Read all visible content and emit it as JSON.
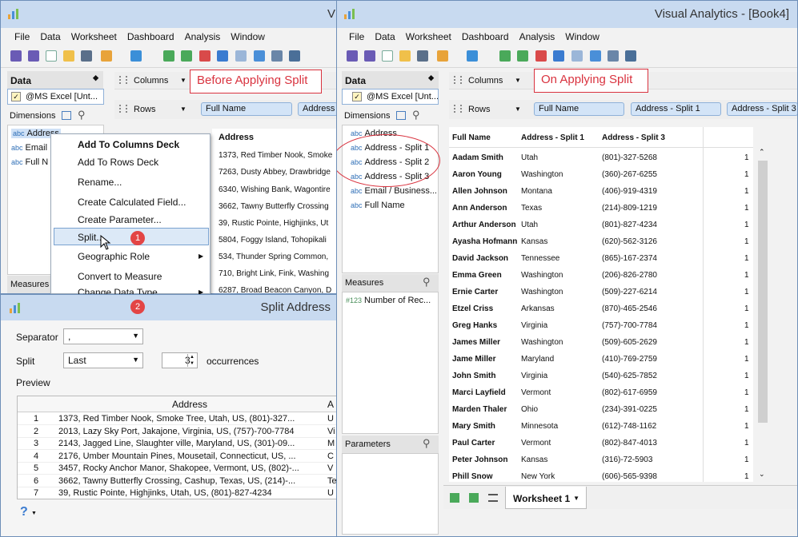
{
  "left_window": {
    "title": "V",
    "menu": [
      "File",
      "Data",
      "Worksheet",
      "Dashboard",
      "Analysis",
      "Window"
    ],
    "data_header": "Data",
    "datasource": "@MS Excel [Unt...",
    "dimensions_label": "Dimensions",
    "measures_label": "Measures",
    "dimension_fields": [
      "Address",
      "Email",
      "Full N"
    ],
    "columns_label": "Columns",
    "rows_label": "Rows",
    "rows_pills": [
      "Full Name",
      "Address"
    ],
    "table_header": "Address",
    "table_rows": [
      "1373, Red Timber Nook, Smoke",
      "7263, Dusty Abbey, Drawbridge",
      "6340, Wishing Bank, Wagontire",
      "3662, Tawny Butterfly Crossing",
      "39, Rustic Pointe, Highjinks, Ut",
      "5804, Foggy Island, Tohopikali",
      "534, Thunder Spring Common,",
      "710, Bright Link, Fink, Washing",
      "6287, Broad Beacon Canyon, D"
    ]
  },
  "callout_before": "Before Applying Split",
  "context_menu": {
    "items": [
      "Add To Columns Deck",
      "Add To Rows Deck",
      "Rename...",
      "Create Calculated Field...",
      "Create Parameter...",
      "Split...",
      "Geographic Role",
      "Convert to Measure",
      "Change Data Type"
    ],
    "badge": "1"
  },
  "split_dialog": {
    "title": "Split Address",
    "badge": "2",
    "separator_label": "Separator",
    "separator_value": ",",
    "split_label": "Split",
    "split_value": "Last",
    "occurrences_value": "3",
    "occurrences_label": "occurrences",
    "preview_label": "Preview",
    "preview_header": "Address",
    "preview_header_2": "A",
    "preview_rows": [
      {
        "n": "1",
        "addr": "1373, Red Timber Nook, Smoke Tree, Utah, US, (801)-327...",
        "c": "U"
      },
      {
        "n": "2",
        "addr": "2013, Lazy Sky Port, Jakajone, Virginia, US, (757)-700-7784",
        "c": "Vi"
      },
      {
        "n": "3",
        "addr": "2143, Jagged Line, Slaughter ville, Maryland, US, (301)-09...",
        "c": "M"
      },
      {
        "n": "4",
        "addr": "2176, Umber Mountain Pines, Mousetail, Connecticut, US, ...",
        "c": "C"
      },
      {
        "n": "5",
        "addr": "3457, Rocky Anchor Manor, Shakopee, Vermont, US, (802)-...",
        "c": "V"
      },
      {
        "n": "6",
        "addr": "3662, Tawny Butterfly Crossing, Cashup, Texas, US, (214)-...",
        "c": "Te"
      },
      {
        "n": "7",
        "addr": "39, Rustic Pointe, Highjinks, Utah, US, (801)-827-4234",
        "c": "U"
      }
    ],
    "help": "?"
  },
  "right_window": {
    "title": "Visual Analytics - [Book4]",
    "menu": [
      "File",
      "Data",
      "Worksheet",
      "Dashboard",
      "Analysis",
      "Window"
    ],
    "data_header": "Data",
    "datasource": "@MS Excel [Unt...",
    "dimensions_label": "Dimensions",
    "dimension_fields": [
      "Address",
      "Address - Split 1",
      "Address - Split 2",
      "Address - Split 3",
      "Email / Business...",
      "Full Name"
    ],
    "measures_label": "Measures",
    "measure_fields": [
      "Number of Rec..."
    ],
    "parameters_label": "Parameters",
    "columns_label": "Columns",
    "rows_label": "Rows",
    "rows_pills": [
      "Full Name",
      "Address - Split 1",
      "Address - Split 3"
    ],
    "headers": [
      "Full Name",
      "Address - Split 1",
      "Address - Split 3"
    ],
    "rows": [
      {
        "name": "Aadam Smith",
        "state": "Utah",
        "phone": "(801)-327-5268",
        "v": "1"
      },
      {
        "name": "Aaron Young",
        "state": "Washington",
        "phone": "(360)-267-6255",
        "v": "1"
      },
      {
        "name": "Allen Johnson",
        "state": "Montana",
        "phone": "(406)-919-4319",
        "v": "1"
      },
      {
        "name": "Ann Anderson",
        "state": "Texas",
        "phone": "(214)-809-1219",
        "v": "1"
      },
      {
        "name": "Arthur Anderson",
        "state": "Utah",
        "phone": "(801)-827-4234",
        "v": "1"
      },
      {
        "name": "Ayasha Hofmann",
        "state": "Kansas",
        "phone": "(620)-562-3126",
        "v": "1"
      },
      {
        "name": "David Jackson",
        "state": "Tennessee",
        "phone": "(865)-167-2374",
        "v": "1"
      },
      {
        "name": "Emma Green",
        "state": "Washington",
        "phone": "(206)-826-2780",
        "v": "1"
      },
      {
        "name": "Ernie Carter",
        "state": "Washington",
        "phone": "(509)-227-6214",
        "v": "1"
      },
      {
        "name": "Etzel Criss",
        "state": "Arkansas",
        "phone": "(870)-465-2546",
        "v": "1"
      },
      {
        "name": "Greg Hanks",
        "state": "Virginia",
        "phone": "(757)-700-7784",
        "v": "1"
      },
      {
        "name": "James Miller",
        "state": "Washington",
        "phone": "(509)-605-2629",
        "v": "1"
      },
      {
        "name": "Jame Miller",
        "state": "Maryland",
        "phone": "(410)-769-2759",
        "v": "1"
      },
      {
        "name": "John Smith",
        "state": "Virginia",
        "phone": "(540)-625-7852",
        "v": "1"
      },
      {
        "name": "Marci Layfield",
        "state": "Vermont",
        "phone": "(802)-617-6959",
        "v": "1"
      },
      {
        "name": "Marden Thaler",
        "state": "Ohio",
        "phone": "(234)-391-0225",
        "v": "1"
      },
      {
        "name": "Mary Smith",
        "state": "Minnesota",
        "phone": "(612)-748-1162",
        "v": "1"
      },
      {
        "name": "Paul Carter",
        "state": "Vermont",
        "phone": "(802)-847-4013",
        "v": "1"
      },
      {
        "name": "Peter Johnson",
        "state": "Kansas",
        "phone": "(316)-72-5903",
        "v": "1"
      },
      {
        "name": "Phill Snow",
        "state": "New York",
        "phone": "(606)-565-9398",
        "v": "1"
      }
    ],
    "sheet_tab": "Worksheet 1"
  },
  "callout_after": "On Applying Split",
  "colors": {
    "accent": "#d9333f",
    "pill": "#d3e4f7",
    "titlebar": "#c8daf0"
  }
}
